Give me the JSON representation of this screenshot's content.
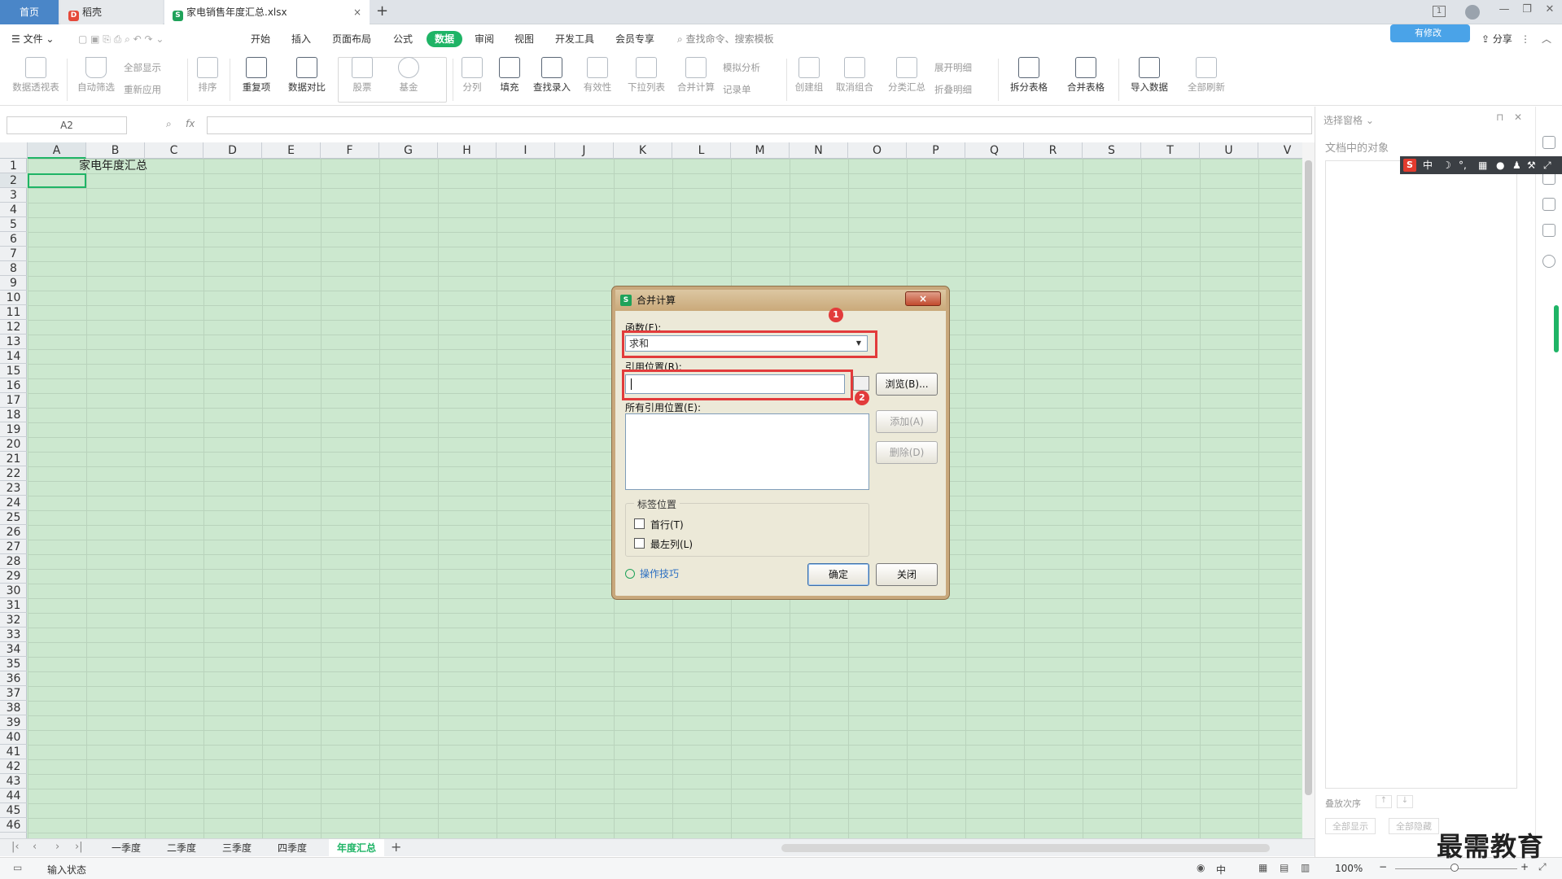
{
  "titlebar": {
    "tab_home": "首页",
    "tab_daoke": "稻壳",
    "tab_file": "家电销售年度汇总.xlsx",
    "close_glyph": "×",
    "new_tab_glyph": "+",
    "window_badge": "1"
  },
  "menubar": {
    "file": "文件",
    "items": [
      "开始",
      "插入",
      "页面布局",
      "公式",
      "数据",
      "审阅",
      "视图",
      "开发工具",
      "会员专享"
    ],
    "active": "数据",
    "search_placeholder": "查找命令、搜索模板",
    "sync": "有修改",
    "share": "分享"
  },
  "ribbon": {
    "pivot": "数据透视表",
    "autofilter": "自动筛选",
    "show_all": "全部显示",
    "reapply": "重新应用",
    "sort": "排序",
    "duplicates": "重复项",
    "compare": "数据对比",
    "stock": "股票",
    "fund": "基金",
    "split": "分列",
    "fill": "填充",
    "lookup": "查找录入",
    "validity": "有效性",
    "dropdown": "下拉列表",
    "consolidate": "合并计算",
    "whatif": "模拟分析",
    "record": "记录单",
    "group": "创建组",
    "ungroup": "取消组合",
    "subtotal": "分类汇总",
    "expand": "展开明细",
    "collapse": "折叠明细",
    "split_table": "拆分表格",
    "merge_table": "合并表格",
    "import": "导入数据",
    "refresh_all": "全部刷新"
  },
  "formulabar": {
    "namebox": "A2",
    "fx": "fx"
  },
  "sheet": {
    "columns": [
      "A",
      "B",
      "C",
      "D",
      "E",
      "F",
      "G",
      "H",
      "I",
      "J",
      "K",
      "L",
      "M",
      "N",
      "O",
      "P",
      "Q",
      "R",
      "S",
      "T",
      "U",
      "V"
    ],
    "rows": [
      "1",
      "2",
      "3",
      "4",
      "5",
      "6",
      "7",
      "8",
      "9",
      "10",
      "11",
      "12",
      "13",
      "14",
      "15",
      "16",
      "17",
      "18",
      "19",
      "20",
      "21",
      "22",
      "23",
      "24",
      "25",
      "26",
      "27",
      "28",
      "29",
      "30",
      "31",
      "32",
      "33",
      "34",
      "35",
      "36",
      "37",
      "38",
      "39",
      "40",
      "41",
      "42",
      "43",
      "44",
      "45",
      "46"
    ],
    "cell_B1": "家电年度汇总",
    "selected_cell": "A2"
  },
  "sheettabs": {
    "tabs": [
      "一季度",
      "二季度",
      "三季度",
      "四季度",
      "年度汇总"
    ],
    "active": "年度汇总",
    "add": "+"
  },
  "statusbar": {
    "mode": "输入状态",
    "ime": "中",
    "zoom": "100%"
  },
  "rightpane": {
    "title": "选择窗格",
    "objects_label": "文档中的对象",
    "order_label": "叠放次序",
    "show_all": "全部显示",
    "hide_all": "全部隐藏"
  },
  "ime_bar": {
    "logo": "S",
    "mode": "中"
  },
  "dialog": {
    "title": "合并计算",
    "close": "×",
    "function_label": "函数(F):",
    "function_value": "求和",
    "ref_label": "引用位置(R):",
    "browse": "浏览(B)...",
    "all_refs_label": "所有引用位置(E):",
    "add": "添加(A)",
    "delete": "删除(D)",
    "label_group": "标签位置",
    "top_row": "首行(T)",
    "left_col": "最左列(L)",
    "tips": "操作技巧",
    "ok": "确定",
    "cancel": "关闭",
    "badge_1": "1",
    "badge_2": "2"
  },
  "colors": {
    "accent": "#1fb466",
    "grid_bg": "#cce8cf",
    "highlight": "#e23b3b"
  },
  "watermark": "最需教育"
}
